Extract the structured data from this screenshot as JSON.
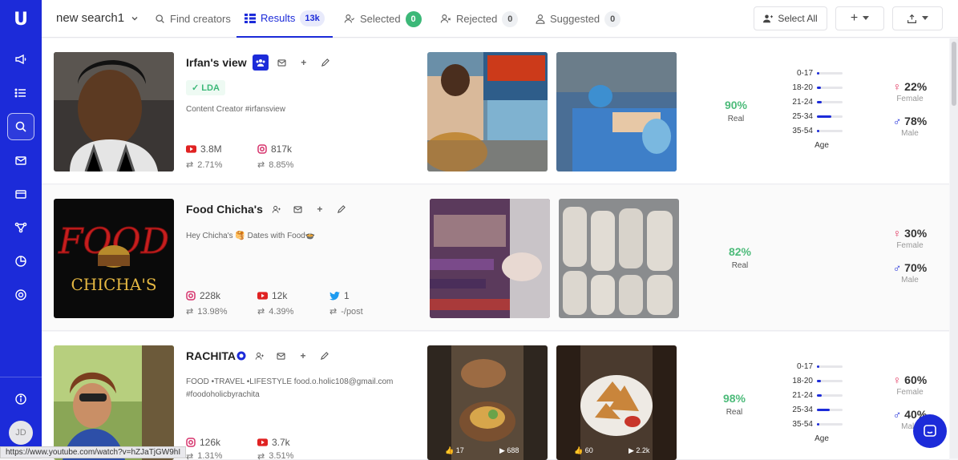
{
  "app": {
    "logo": "U",
    "user_initials": "JD",
    "status_url": "https://www.youtube.com/watch?v=hZJaTjGW9hI"
  },
  "sidebar": {
    "items": [
      {
        "icon": "megaphone-icon"
      },
      {
        "icon": "list-icon"
      },
      {
        "icon": "search-icon",
        "active": true
      },
      {
        "icon": "mail-icon"
      },
      {
        "icon": "card-icon"
      },
      {
        "icon": "flow-icon"
      },
      {
        "icon": "pie-chart-icon"
      },
      {
        "icon": "support-icon"
      },
      {
        "icon": "info-icon"
      }
    ]
  },
  "topbar": {
    "search_name": "new search1",
    "tabs": [
      {
        "label": "Find creators"
      },
      {
        "label": "Results",
        "count": "13k"
      },
      {
        "label": "Selected",
        "count": "0"
      },
      {
        "label": "Rejected",
        "count": "0"
      },
      {
        "label": "Suggested",
        "count": "0"
      }
    ],
    "select_all": "Select All"
  },
  "creators": [
    {
      "name": "Irfan's view",
      "tag": "LDA",
      "bio": "Content Creator #irfansview",
      "stats": [
        {
          "platform": "youtube",
          "followers": "3.8M",
          "engagement": "2.71%"
        },
        {
          "platform": "instagram",
          "followers": "817k",
          "engagement": "8.85%"
        }
      ],
      "real": "90%",
      "real_label": "Real",
      "age": {
        "title": "Age",
        "groups": [
          {
            "label": "0-17",
            "value": 0.1
          },
          {
            "label": "18-20",
            "value": 0.15
          },
          {
            "label": "21-24",
            "value": 0.2
          },
          {
            "label": "25-34",
            "value": 0.55
          },
          {
            "label": "35-54",
            "value": 0.1
          }
        ]
      },
      "female": "22%",
      "female_label": "Female",
      "male": "78%",
      "male_label": "Male",
      "media": [
        {
          "caption": ""
        },
        {
          "caption": ""
        }
      ]
    },
    {
      "name": "Food Chicha's",
      "bio": "Hey Chicha's 🥞 Dates with Food🍲",
      "stats": [
        {
          "platform": "instagram",
          "followers": "228k",
          "engagement": "13.98%"
        },
        {
          "platform": "youtube",
          "followers": "12k",
          "engagement": "4.39%"
        },
        {
          "platform": "twitter",
          "followers": "1",
          "engagement": "-/post"
        }
      ],
      "real": "82%",
      "real_label": "Real",
      "female": "30%",
      "female_label": "Female",
      "male": "70%",
      "male_label": "Male",
      "thumb_text": {
        "line1": "FOOD",
        "line2": "CHICHA'S"
      }
    },
    {
      "name": "RACHITA",
      "bio": "FOOD •TRAVEL •LIFESTYLE food.o.holic108@gmail.com\n#foodoholicbyrachita",
      "stats": [
        {
          "platform": "instagram",
          "followers": "126k",
          "engagement": "1.31%"
        },
        {
          "platform": "youtube",
          "followers": "3.7k",
          "engagement": "3.51%"
        }
      ],
      "real": "98%",
      "real_label": "Real",
      "age": {
        "title": "Age",
        "groups": [
          {
            "label": "0-17",
            "value": 0.1
          },
          {
            "label": "18-20",
            "value": 0.15
          },
          {
            "label": "21-24",
            "value": 0.2
          },
          {
            "label": "25-34",
            "value": 0.5
          },
          {
            "label": "35-54",
            "value": 0.1
          }
        ]
      },
      "female": "60%",
      "female_label": "Female",
      "male": "40%",
      "male_label": "Male",
      "media_stats": [
        {
          "likes": "17",
          "views": "688"
        },
        {
          "likes": "60",
          "views": "2.2k"
        }
      ]
    }
  ],
  "colors": {
    "primary": "#1c2bd9",
    "green": "#3cb878",
    "female": "#e0305a",
    "male": "#1c2bd9"
  }
}
